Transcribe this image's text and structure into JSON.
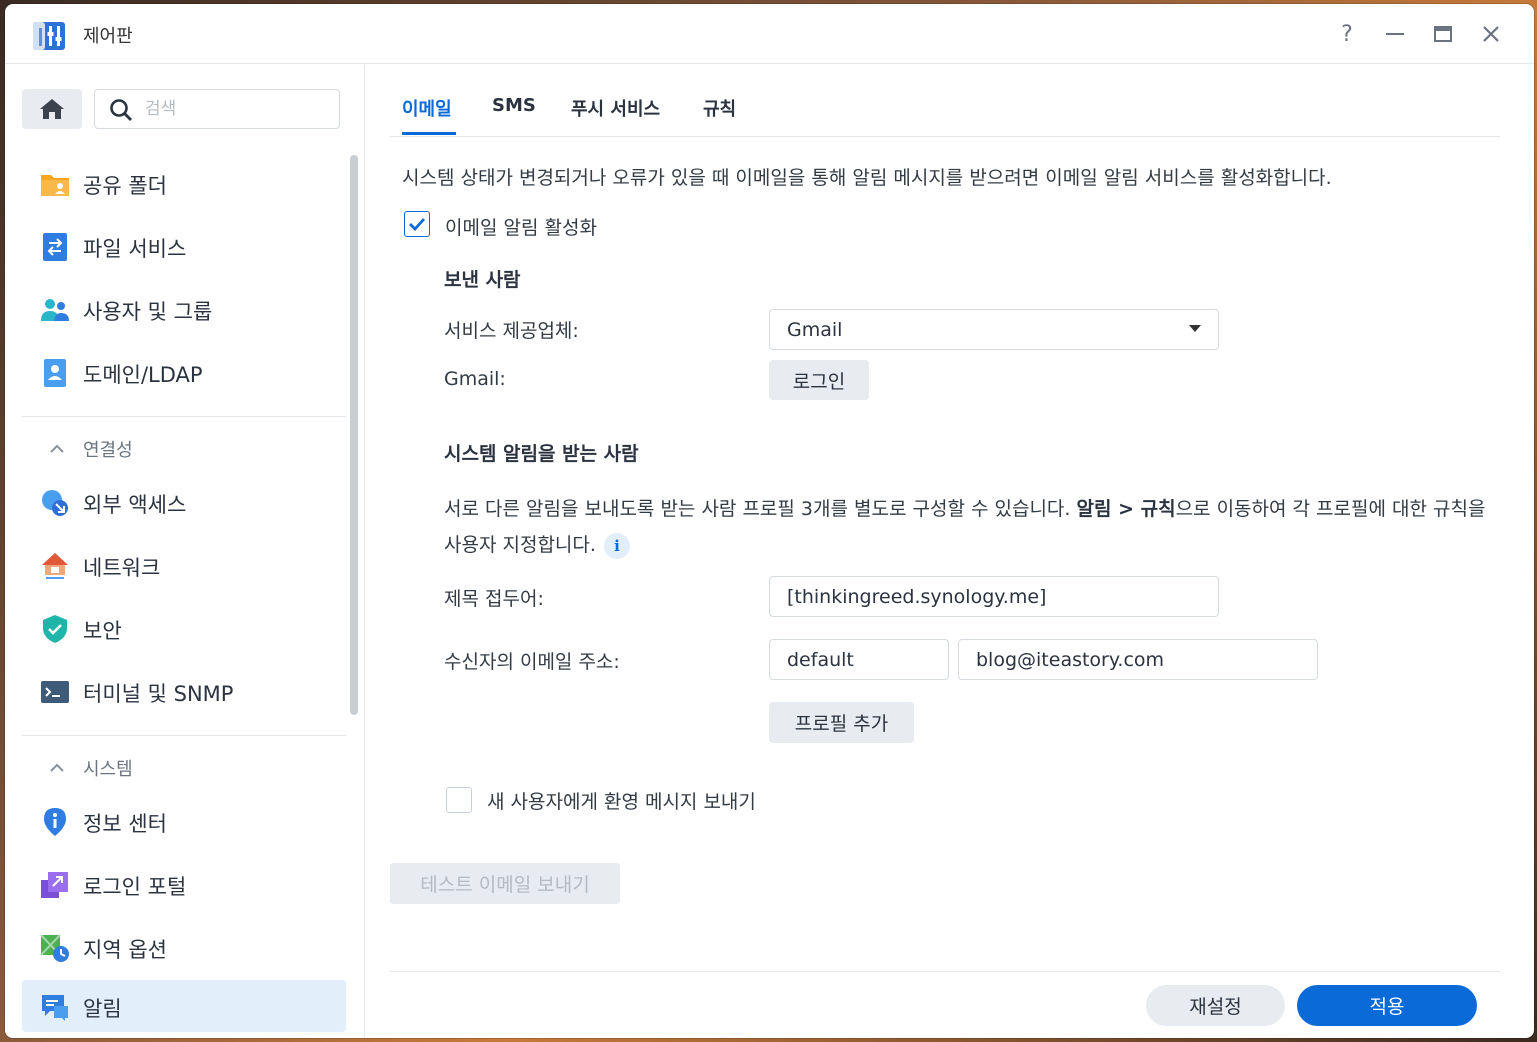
{
  "window": {
    "title": "제어판",
    "help_glyph": "?",
    "minimize_glyph": "—",
    "close_glyph": "✕"
  },
  "sidebar": {
    "search_placeholder": "검색",
    "items_top": [
      {
        "label": "공유 폴더",
        "icon": "shared-folder-icon"
      },
      {
        "label": "파일 서비스",
        "icon": "file-services-icon"
      },
      {
        "label": "사용자 및 그룹",
        "icon": "users-groups-icon"
      },
      {
        "label": "도메인/LDAP",
        "icon": "domain-ldap-icon"
      }
    ],
    "section_connectivity": "연결성",
    "items_connectivity": [
      {
        "label": "외부 액세스",
        "icon": "external-access-icon"
      },
      {
        "label": "네트워크",
        "icon": "network-icon"
      },
      {
        "label": "보안",
        "icon": "security-icon"
      },
      {
        "label": "터미널 및 SNMP",
        "icon": "terminal-icon"
      }
    ],
    "section_system": "시스템",
    "items_system": [
      {
        "label": "정보 센터",
        "icon": "info-center-icon"
      },
      {
        "label": "로그인 포털",
        "icon": "login-portal-icon"
      },
      {
        "label": "지역 옵션",
        "icon": "regional-options-icon"
      },
      {
        "label": "알림",
        "icon": "notification-icon",
        "active": true
      }
    ]
  },
  "tabs": {
    "email": "이메일",
    "sms": "SMS",
    "push": "푸시 서비스",
    "rules": "규칙"
  },
  "email": {
    "description": "시스템 상태가 변경되거나 오류가 있을 때 이메일을 통해 알림 메시지를 받으려면 이메일 알림 서비스를 활성화합니다.",
    "enable_label": "이메일 알림 활성화",
    "enable_checked": true,
    "sender_title": "보낸 사람",
    "provider_label": "서비스 제공업체:",
    "provider_value": "Gmail",
    "gmail_label": "Gmail:",
    "login_button": "로그인",
    "recipients_title": "시스템 알림을 받는 사람",
    "info_part1": "서로 다른 알림을 보내도록 받는 사람 프로필 3개를 별도로 구성할 수 있습니다. ",
    "info_bold1": "알림",
    "info_sep": " > ",
    "info_bold2": "규칙",
    "info_part2": "으로 이동하여 각 프로필에 대한 규칙을 사용자 지정합니다.",
    "info_icon_glyph": "i",
    "subject_label": "제목 접두어:",
    "subject_value": "[thinkingreed.synology.me]",
    "recipient_label": "수신자의 이메일 주소:",
    "recipient_profile": "default",
    "recipient_email": "blog@iteastory.com",
    "add_profile_button": "프로필 추가",
    "welcome_label": "새 사용자에게 환영 메시지 보내기",
    "welcome_checked": false,
    "test_button": "테스트 이메일 보내기"
  },
  "footer": {
    "reset_button": "재설정",
    "apply_button": "적용"
  },
  "colors": {
    "accent": "#0a6ad8",
    "active_bg": "#e3eefb"
  }
}
